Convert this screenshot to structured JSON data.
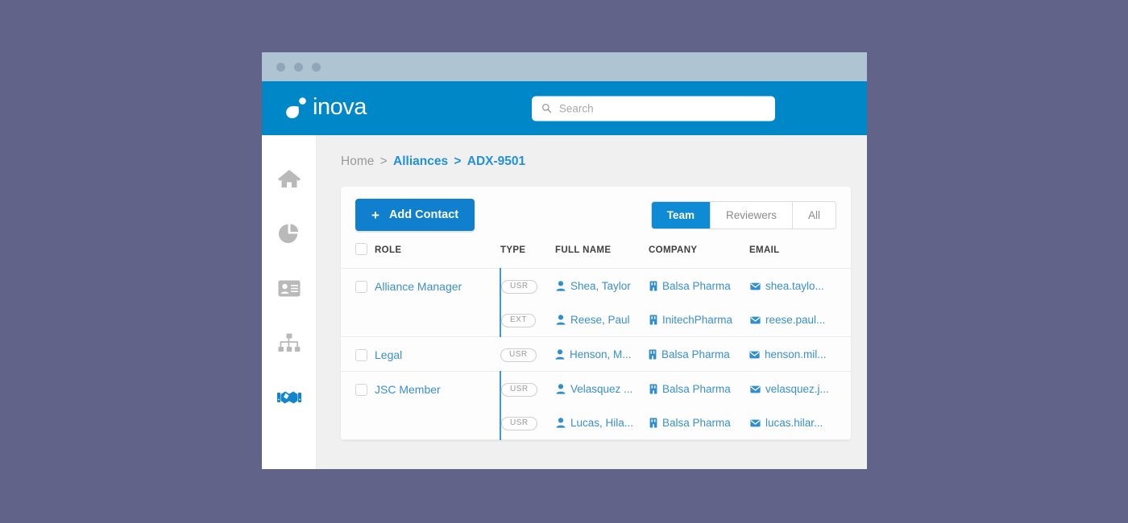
{
  "window": {
    "dots": [
      "close",
      "minimize",
      "maximize"
    ]
  },
  "topbar": {
    "logo_text": "inova",
    "search": {
      "placeholder": "Search",
      "value": ""
    }
  },
  "sidebar": {
    "items": [
      {
        "name": "home",
        "icon": "home-icon",
        "active": false
      },
      {
        "name": "analytics",
        "icon": "pie-chart-icon",
        "active": false
      },
      {
        "name": "contacts",
        "icon": "id-card-icon",
        "active": false
      },
      {
        "name": "organization",
        "icon": "sitemap-icon",
        "active": false
      },
      {
        "name": "alliances",
        "icon": "handshake-icon",
        "active": true
      }
    ]
  },
  "breadcrumb": {
    "home": "Home",
    "separator": ">",
    "section": "Alliances",
    "separator2": ">",
    "current": "ADX-9501"
  },
  "toolbar": {
    "add_label": "Add Contact",
    "add_plus": "+",
    "tabs": [
      {
        "label": "Team",
        "active": true
      },
      {
        "label": "Reviewers",
        "active": false
      },
      {
        "label": "All",
        "active": false
      }
    ]
  },
  "table": {
    "columns": [
      "ROLE",
      "TYPE",
      "FULL NAME",
      "COMPANY",
      "EMAIL"
    ],
    "rows": [
      {
        "role": "Alliance Manager",
        "contacts": [
          {
            "type": "USR",
            "full_name": "Shea, Taylor",
            "company": "Balsa Pharma",
            "email": "shea.taylo..."
          },
          {
            "type": "EXT",
            "full_name": "Reese, Paul",
            "company": "InitechPharma",
            "email": "reese.paul..."
          }
        ]
      },
      {
        "role": "Legal",
        "contacts": [
          {
            "type": "USR",
            "full_name": "Henson, M...",
            "company": "Balsa Pharma",
            "email": "henson.mil..."
          }
        ]
      },
      {
        "role": "JSC Member",
        "contacts": [
          {
            "type": "USR",
            "full_name": "Velasquez ...",
            "company": "Balsa Pharma",
            "email": "velasquez.j..."
          },
          {
            "type": "USR",
            "full_name": "Lucas, Hila...",
            "company": "Balsa Pharma",
            "email": "lucas.hilar..."
          }
        ]
      }
    ]
  },
  "colors": {
    "page_background": "#626388",
    "titlebar": "#aec4d2",
    "brand_blue": "#0087c8",
    "accent_blue": "#0f8ad4",
    "link_blue": "#3a8fd0",
    "content_background": "#f0f0f0"
  }
}
